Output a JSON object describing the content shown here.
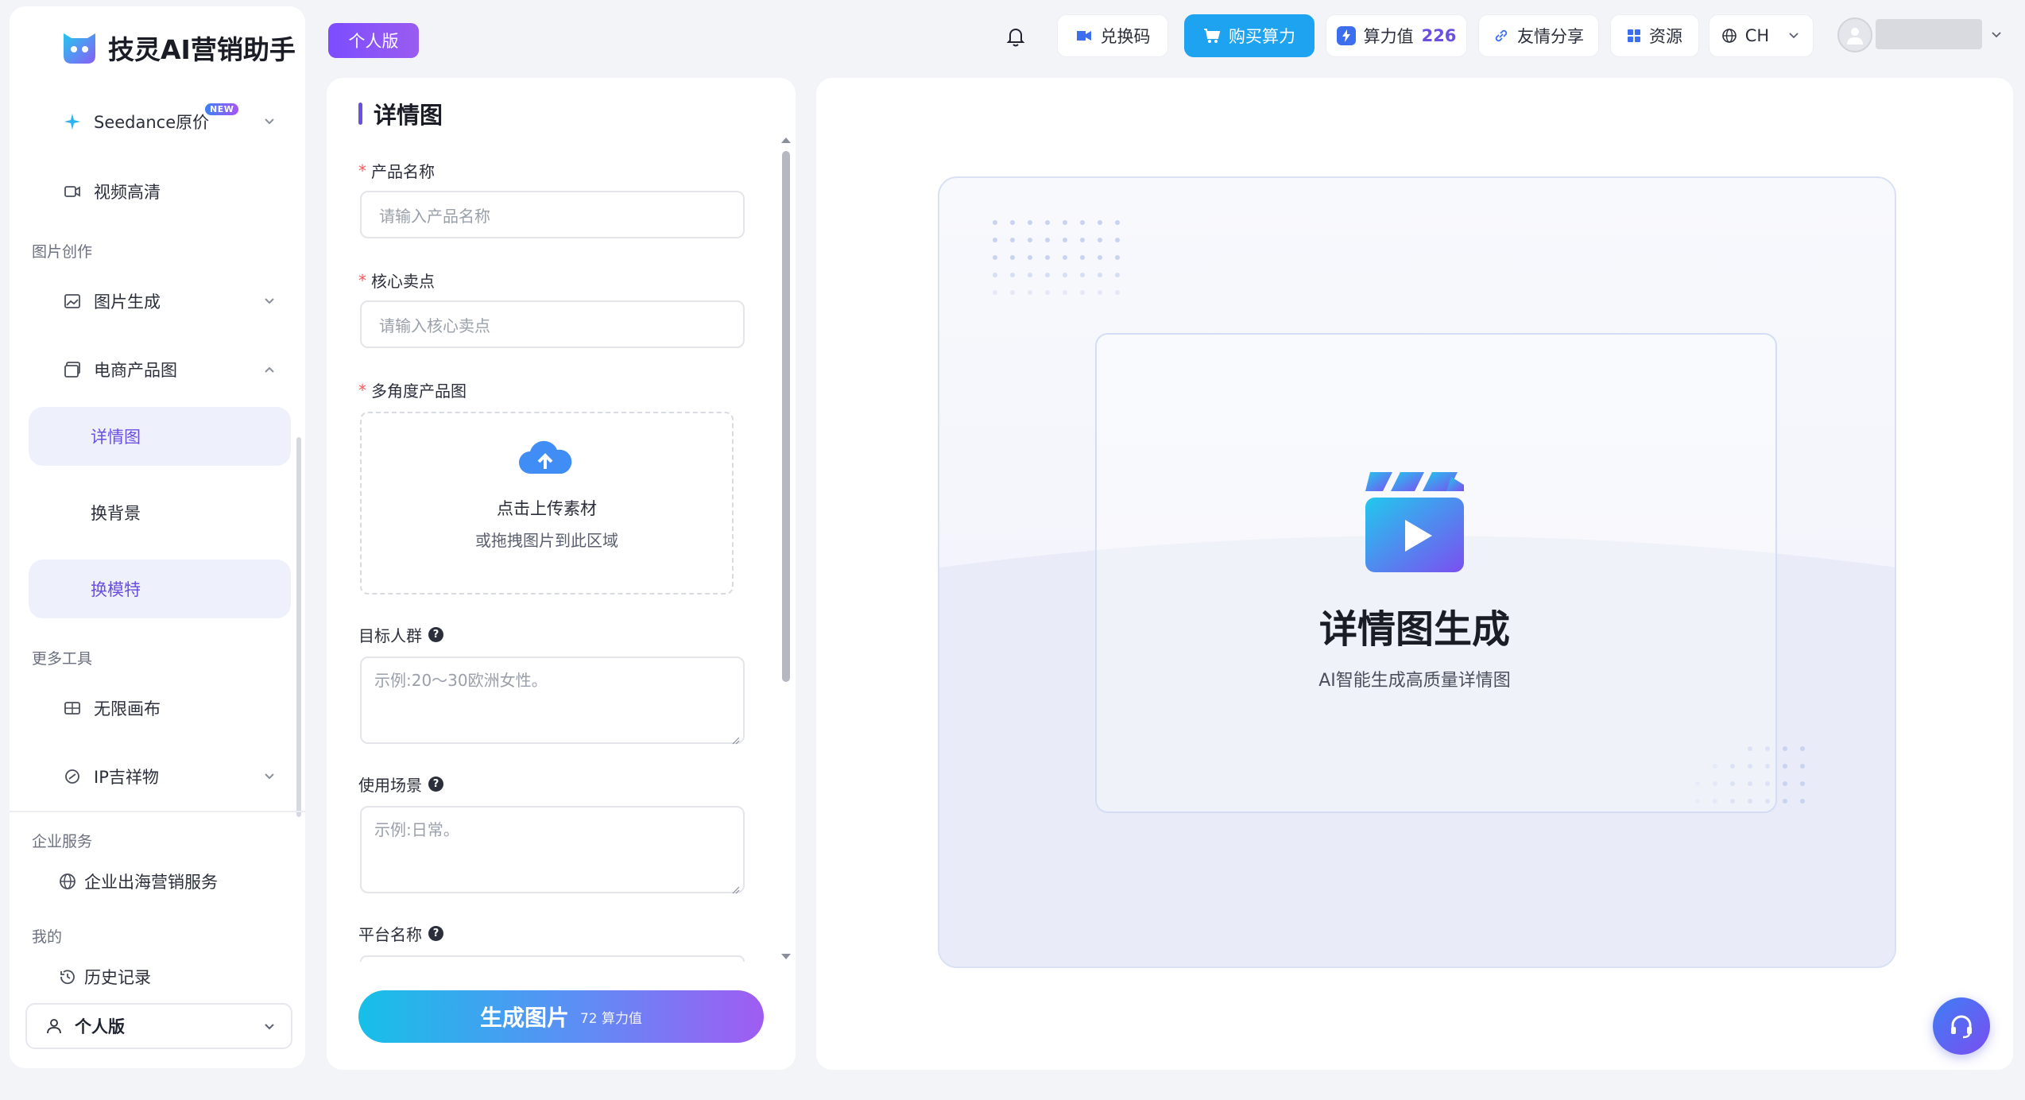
{
  "app": {
    "title": "技灵AI营销助手",
    "plan_badge": "个人版"
  },
  "sidebar": {
    "items": [
      {
        "label": "Seedance原价",
        "badge": "NEW"
      },
      {
        "label": "视频高清"
      }
    ],
    "section_image": "图片创作",
    "image_gen": "图片生成",
    "ecom": "电商产品图",
    "ecom_sub": [
      "详情图",
      "换背景",
      "换模特"
    ],
    "section_more": "更多工具",
    "canvas": "无限画布",
    "ip": "IP吉祥物",
    "section_enterprise": "企业服务",
    "enterprise_item": "企业出海营销服务",
    "section_mine": "我的",
    "history": "历史记录",
    "plan_select": "个人版"
  },
  "header": {
    "redeem": "兑换码",
    "buy": "购买算力",
    "power_label": "算力值",
    "power_value": "226",
    "share": "友情分享",
    "resources": "资源",
    "lang": "CH"
  },
  "form": {
    "title": "详情图",
    "product_name_label": "产品名称",
    "product_name_placeholder": "请输入产品名称",
    "selling_label": "核心卖点",
    "selling_placeholder": "请输入核心卖点",
    "images_label": "多角度产品图",
    "upload_line1": "点击上传素材",
    "upload_line2": "或拖拽图片到此区域",
    "audience_label": "目标人群",
    "audience_placeholder": "示例:20～30欧洲女性。",
    "scene_label": "使用场景",
    "scene_placeholder": "示例:日常。",
    "platform_label": "平台名称",
    "generate": "生成图片",
    "generate_cost": "72 算力值"
  },
  "preview": {
    "title": "详情图生成",
    "subtitle": "AI智能生成高质量详情图"
  },
  "colors": {
    "accent": "#6a4fe0",
    "buy": "#1ea3f0",
    "power": "#6a4fe0"
  }
}
